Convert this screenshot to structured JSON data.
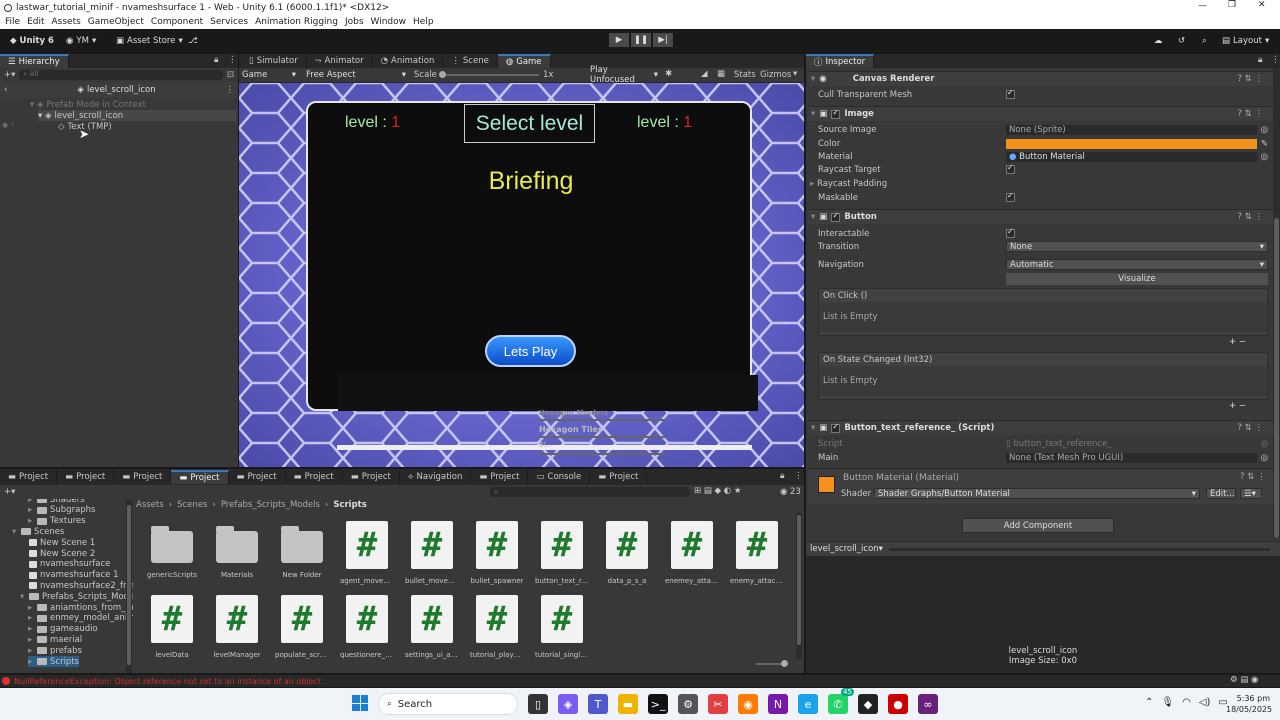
{
  "window": {
    "title": "lastwar_tutorial_minif - nvameshsurface 1 - Web - Unity 6.1 (6000.1.1f1)* <DX12>"
  },
  "menu": [
    "File",
    "Edit",
    "Assets",
    "GameObject",
    "Component",
    "Services",
    "Animation Rigging",
    "Jobs",
    "Window",
    "Help"
  ],
  "toolbar": {
    "unity_label": "Unity 6",
    "account": "YM",
    "asset_store": "Asset Store",
    "layout": "Layout"
  },
  "hierarchy": {
    "tab": "Hierarchy",
    "search_placeholder": "All",
    "breadcrumb": "level_scroll_icon",
    "items": [
      "Prefab Mode in Context",
      "level_scroll_icon",
      "Text (TMP)"
    ]
  },
  "center_tabs": [
    "Simulator",
    "Animator",
    "Animation",
    "Scene",
    "Game"
  ],
  "game_toolbar": {
    "display": "Game",
    "aspect": "Free Aspect",
    "scale_label": "Scale",
    "scale_value": "1x",
    "play_mode": "Play Unfocused",
    "stats": "Stats",
    "gizmos": "Gizmos"
  },
  "game": {
    "level_left_label": "level : ",
    "level_left_value": "1",
    "level_right_label": "level : ",
    "level_right_value": "1",
    "title": "Select level",
    "subtitle": "Briefing",
    "button": "Lets Play",
    "bg_item_1": "Hexagon Shaders",
    "bg_item_2": "Hexagon Tiles",
    "bg_item_3": "Bl..."
  },
  "inspector": {
    "tab": "Inspector",
    "canvas_renderer": "Canvas Renderer",
    "cull_label": "Cull Transparent Mesh",
    "image": "Image",
    "source_image_label": "Source Image",
    "source_image_value": "None (Sprite)",
    "color_label": "Color",
    "color_value": "#f5921e",
    "material_label": "Material",
    "material_value": "Button Material",
    "raycast_target": "Raycast Target",
    "raycast_padding": "Raycast Padding",
    "maskable": "Maskable",
    "button": "Button",
    "interactable": "Interactable",
    "transition_label": "Transition",
    "transition_value": "None",
    "navigation_label": "Navigation",
    "navigation_value": "Automatic",
    "visualize": "Visualize",
    "onclick": "On Click ()",
    "list_empty_1": "List is Empty",
    "onstate": "On State Changed (Int32)",
    "list_empty_2": "List is Empty",
    "script_comp": "Button_text_reference_ (Script)",
    "script_label": "Script",
    "script_value": "button_text_reference_",
    "main_label": "Main",
    "main_value": "None (Text Mesh Pro UGUI)",
    "mat_name": "Button Material (Material)",
    "shader_label": "Shader",
    "shader_value": "Shader Graphs/Button Material",
    "edit": "Edit...",
    "add_component": "Add Component",
    "footer_obj": "level_scroll_icon",
    "preview_name": "level_scroll_icon",
    "preview_size": "Image Size: 0x0"
  },
  "project_tabs": [
    "Project",
    "Project",
    "Project",
    "Project",
    "Project",
    "Project",
    "Project",
    "Navigation",
    "Project",
    "Console",
    "Project"
  ],
  "project": {
    "breadcrumb": [
      "Assets",
      "Scenes",
      "Prefabs_Scripts_Models",
      "Scripts"
    ],
    "count": "23",
    "tree": [
      {
        "label": "Shaders",
        "indent": 2,
        "type": "folder"
      },
      {
        "label": "Subgraphs",
        "indent": 2,
        "type": "folder"
      },
      {
        "label": "Textures",
        "indent": 2,
        "type": "folder"
      },
      {
        "label": "Scenes",
        "indent": 0,
        "type": "folder"
      },
      {
        "label": "New Scene 1",
        "indent": 1,
        "type": "scene"
      },
      {
        "label": "New Scene 2",
        "indent": 1,
        "type": "scene"
      },
      {
        "label": "nvameshsurface",
        "indent": 1,
        "type": "scene"
      },
      {
        "label": "nvameshsurface 1",
        "indent": 1,
        "type": "scene"
      },
      {
        "label": "nvameshsurface2_frie",
        "indent": 1,
        "type": "scene"
      },
      {
        "label": "Prefabs_Scripts_Mode",
        "indent": 1,
        "type": "folder"
      },
      {
        "label": "aniamtions_from_m",
        "indent": 2,
        "type": "folder"
      },
      {
        "label": "enmey_model_anim",
        "indent": 2,
        "type": "folder"
      },
      {
        "label": "gameaudio",
        "indent": 2,
        "type": "folder"
      },
      {
        "label": "maerial",
        "indent": 2,
        "type": "folder"
      },
      {
        "label": "prefabs",
        "indent": 2,
        "type": "folder"
      },
      {
        "label": "Scripts",
        "indent": 2,
        "type": "folder"
      }
    ],
    "files": [
      {
        "name": "genericScripts",
        "kind": "folder"
      },
      {
        "name": "Materials",
        "kind": "folder"
      },
      {
        "name": "New Folder",
        "kind": "folder"
      },
      {
        "name": "agent_movement",
        "kind": "script"
      },
      {
        "name": "bullet_movement",
        "kind": "script"
      },
      {
        "name": "bullet_spawner",
        "kind": "script"
      },
      {
        "name": "button_text_ref...",
        "kind": "script"
      },
      {
        "name": "data_p_s_a",
        "kind": "script"
      },
      {
        "name": "enemey_attack_",
        "kind": "script"
      },
      {
        "name": "enemy_attack_s...",
        "kind": "script"
      },
      {
        "name": "levelData",
        "kind": "script"
      },
      {
        "name": "levelManager",
        "kind": "script"
      },
      {
        "name": "populate_scroll...",
        "kind": "script"
      },
      {
        "name": "questionere_data",
        "kind": "script"
      },
      {
        "name": "settings_ui_adj...",
        "kind": "script"
      },
      {
        "name": "tutorial_player...",
        "kind": "script"
      },
      {
        "name": "tutorial_singlet...",
        "kind": "script"
      }
    ]
  },
  "status": {
    "error": "NullReferenceException: Object reference not set to an instance of an object"
  },
  "taskbar": {
    "search": "Search",
    "time": "5:36 pm",
    "date": "18/05/2025",
    "badge": "45"
  }
}
